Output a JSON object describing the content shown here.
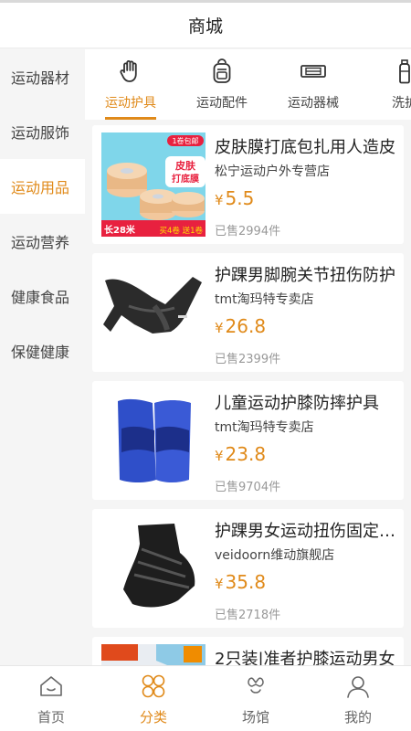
{
  "header": {
    "title": "商城"
  },
  "sidebar": {
    "items": [
      {
        "label": "运动器材",
        "active": false
      },
      {
        "label": "运动服饰",
        "active": false
      },
      {
        "label": "运动用品",
        "active": true
      },
      {
        "label": "运动营养",
        "active": false
      },
      {
        "label": "健康食品",
        "active": false
      },
      {
        "label": "保健健康",
        "active": false
      }
    ]
  },
  "subtabs": [
    {
      "label": "运动护具",
      "icon": "hand-icon",
      "active": true
    },
    {
      "label": "运动配件",
      "icon": "backpack-icon",
      "active": false
    },
    {
      "label": "运动器械",
      "icon": "equipment-icon",
      "active": false
    },
    {
      "label": "洗护",
      "icon": "bottle-icon",
      "active": false
    }
  ],
  "products": [
    {
      "name": "皮肤膜打底包扎用人造皮",
      "shop": "松宁运动户外专营店",
      "price": "5.5",
      "sold": "已售2994件",
      "image": "skin-tape-image",
      "image_text": {
        "top": "1卷包邮",
        "badge1": "皮肤",
        "badge2": "打底膜",
        "bottom_left": "长28米",
        "bottom_right": "买4卷 送1卷"
      }
    },
    {
      "name": "护踝男脚腕关节扭伤防护",
      "shop": "tmt淘玛特专卖店",
      "price": "26.8",
      "sold": "已售2399件",
      "image": "ankle-brace-image"
    },
    {
      "name": "儿童运动护膝防摔护具",
      "shop": "tmt淘玛特专卖店",
      "price": "23.8",
      "sold": "已售9704件",
      "image": "knee-pad-image"
    },
    {
      "name": "护踝男女运动扭伤固定护具",
      "shop": "veidoorn维动旗舰店",
      "price": "35.8",
      "sold": "已售2718件",
      "image": "ankle-wrap-image"
    },
    {
      "name": "2只装|准者护膝运动男女",
      "shop": "",
      "price": "",
      "sold": "",
      "image": "knee-support-image"
    }
  ],
  "currency": "¥",
  "tabbar": [
    {
      "label": "首页",
      "icon": "home-icon",
      "active": false
    },
    {
      "label": "分类",
      "icon": "category-icon",
      "active": true
    },
    {
      "label": "场馆",
      "icon": "venue-icon",
      "active": false
    },
    {
      "label": "我的",
      "icon": "user-icon",
      "active": false
    }
  ],
  "colors": {
    "accent": "#e08a1a",
    "background": "#f5f5f5"
  }
}
